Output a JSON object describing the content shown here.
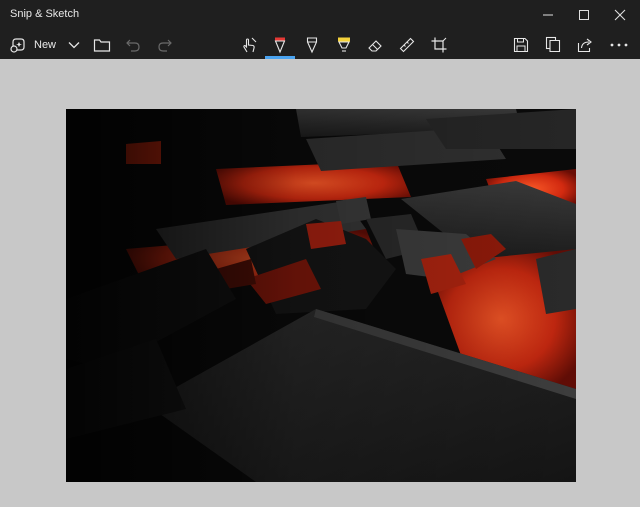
{
  "window": {
    "title": "Snip & Sketch"
  },
  "toolbar": {
    "new_label": "New",
    "items": [
      {
        "name": "new-snip-icon"
      },
      {
        "name": "chevron-down-icon"
      },
      {
        "name": "open-folder-icon"
      },
      {
        "name": "undo-icon"
      },
      {
        "name": "redo-icon"
      },
      {
        "name": "touch-writing-icon"
      },
      {
        "name": "ballpoint-pen-icon"
      },
      {
        "name": "pencil-icon"
      },
      {
        "name": "highlighter-icon"
      },
      {
        "name": "eraser-icon"
      },
      {
        "name": "ruler-icon"
      },
      {
        "name": "crop-icon"
      },
      {
        "name": "save-icon"
      },
      {
        "name": "copy-icon"
      },
      {
        "name": "share-icon"
      },
      {
        "name": "more-icon"
      }
    ],
    "selected_tool": "ballpoint-pen"
  },
  "colors": {
    "titlebar_bg": "#1f1f1f",
    "canvas_bg": "#c8c8c8",
    "accent": "#4aa3f0",
    "pen_color": "#e53935",
    "highlighter_color": "#f4d23b"
  }
}
